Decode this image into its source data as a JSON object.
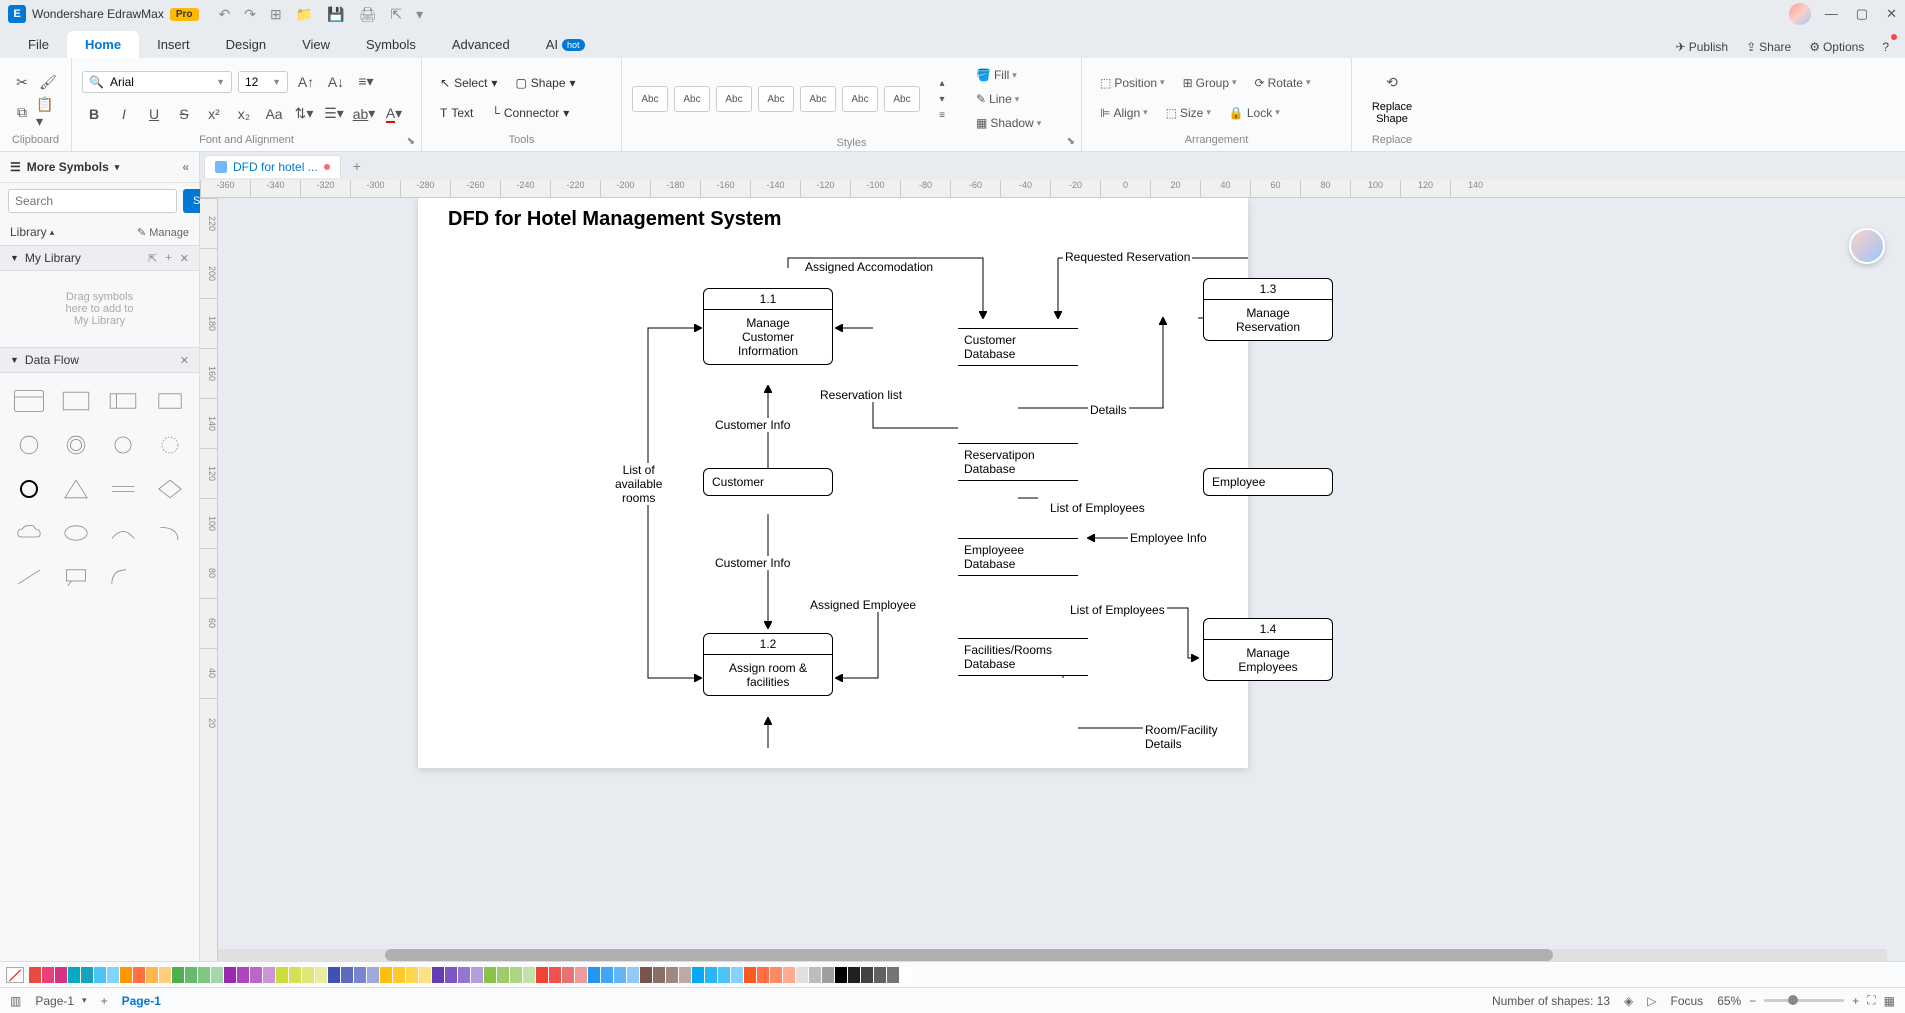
{
  "app": {
    "title": "Wondershare EdrawMax",
    "pro": "Pro"
  },
  "menu": {
    "tabs": [
      "File",
      "Home",
      "Insert",
      "Design",
      "View",
      "Symbols",
      "Advanced",
      "AI"
    ],
    "active": "Home",
    "hot": "hot",
    "right": {
      "publish": "Publish",
      "share": "Share",
      "options": "Options"
    }
  },
  "ribbon": {
    "clipboard": "Clipboard",
    "font_align": "Font and Alignment",
    "tools": "Tools",
    "styles": "Styles",
    "arrangement": "Arrangement",
    "replace": "Replace",
    "font_name": "Arial",
    "font_size": "12",
    "select": "Select",
    "shape": "Shape",
    "text": "Text",
    "connector": "Connector",
    "style_chip": "Abc",
    "fill": "Fill",
    "line": "Line",
    "shadow": "Shadow",
    "position": "Position",
    "group": "Group",
    "rotate": "Rotate",
    "align": "Align",
    "size": "Size",
    "lock": "Lock",
    "replace_shape": "Replace\nShape",
    "replace_label": "Replace"
  },
  "left": {
    "more_symbols": "More Symbols",
    "search_ph": "Search",
    "search_btn": "Search",
    "library": "Library",
    "manage": "Manage",
    "mylibrary": "My Library",
    "dropzone": "Drag symbols\nhere to add to\nMy Library",
    "dataflow": "Data Flow"
  },
  "doc": {
    "tab_name": "DFD for hotel ..."
  },
  "ruler_h": [
    "-360",
    "-340",
    "-320",
    "-300",
    "-280",
    "-260",
    "-240",
    "-220",
    "-200",
    "-180",
    "-160",
    "-140",
    "-120",
    "-100",
    "-80",
    "-60",
    "-40",
    "-20",
    "0",
    "20",
    "40",
    "60",
    "80",
    "100",
    "120",
    "140"
  ],
  "ruler_v": [
    "220",
    "200",
    "180",
    "160",
    "140",
    "120",
    "100",
    "80",
    "60",
    "40",
    "20"
  ],
  "diagram": {
    "title": "DFD for Hotel Management System",
    "p11_num": "1.1",
    "p11_body": "Manage\nCustomer\nInformation",
    "p12_num": "1.2",
    "p12_body": "Assign room &\nfacilities",
    "p13_num": "1.3",
    "p13_body": "Manage\nReservation",
    "p14_num": "1.4",
    "p14_body": "Manage\nEmployees",
    "ent_customer": "Customer",
    "ent_employee": "Employee",
    "ds_customer": "Customer\nDatabase",
    "ds_reservation": "Reservatipon\nDatabase",
    "ds_employee": "Employeee\nDatabase",
    "ds_facilities": "Facilities/Rooms\nDatabase",
    "fl_assigned_acc": "Assigned Accomodation",
    "fl_req_res": "Requested Reservation",
    "fl_res_list": "Reservation list",
    "fl_cust_info1": "Customer Info",
    "fl_cust_info2": "Customer Info",
    "fl_list_rooms": "List of\navailable\nrooms",
    "fl_details": "Details",
    "fl_list_emp1": "List of Employees",
    "fl_list_emp2": "List of Employees",
    "fl_emp_info": "Employee Info",
    "fl_assigned_emp": "Assigned Employee",
    "fl_room_details": "Room/Facility Details"
  },
  "colors": [
    "#e74c3c",
    "#ec407a",
    "#d63384",
    "#00acc1",
    "#17a2b8",
    "#4fc3f7",
    "#81d4fa",
    "#ff9800",
    "#ff7043",
    "#ffb74d",
    "#ffcc80",
    "#4caf50",
    "#66bb6a",
    "#81c784",
    "#a5d6a7",
    "#9c27b0",
    "#ab47bc",
    "#ba68c8",
    "#ce93d8",
    "#cddc39",
    "#d4e157",
    "#dce775",
    "#e6ee9c",
    "#3f51b5",
    "#5c6bc0",
    "#7986cb",
    "#9fa8da",
    "#ffc107",
    "#ffca28",
    "#ffd54f",
    "#ffe082",
    "#673ab7",
    "#7e57c2",
    "#9575cd",
    "#b39ddb",
    "#8bc34a",
    "#9ccc65",
    "#aed581",
    "#c5e1a5",
    "#f44336",
    "#ef5350",
    "#e57373",
    "#ef9a9a",
    "#2196f3",
    "#42a5f5",
    "#64b5f6",
    "#90caf9",
    "#795548",
    "#8d6e63",
    "#a1887f",
    "#bcaaa4",
    "#03a9f4",
    "#29b6f6",
    "#4fc3f7",
    "#81d4fa",
    "#ff5722",
    "#ff7043",
    "#ff8a65",
    "#ffab91",
    "#e0e0e0",
    "#bdbdbd",
    "#9e9e9e",
    "#000000",
    "#212121",
    "#424242",
    "#616161",
    "#757575",
    "#ffffff"
  ],
  "status": {
    "page_sel": "Page-1",
    "page_tab": "Page-1",
    "shapes": "Number of shapes: 13",
    "focus": "Focus",
    "zoom": "65%"
  }
}
